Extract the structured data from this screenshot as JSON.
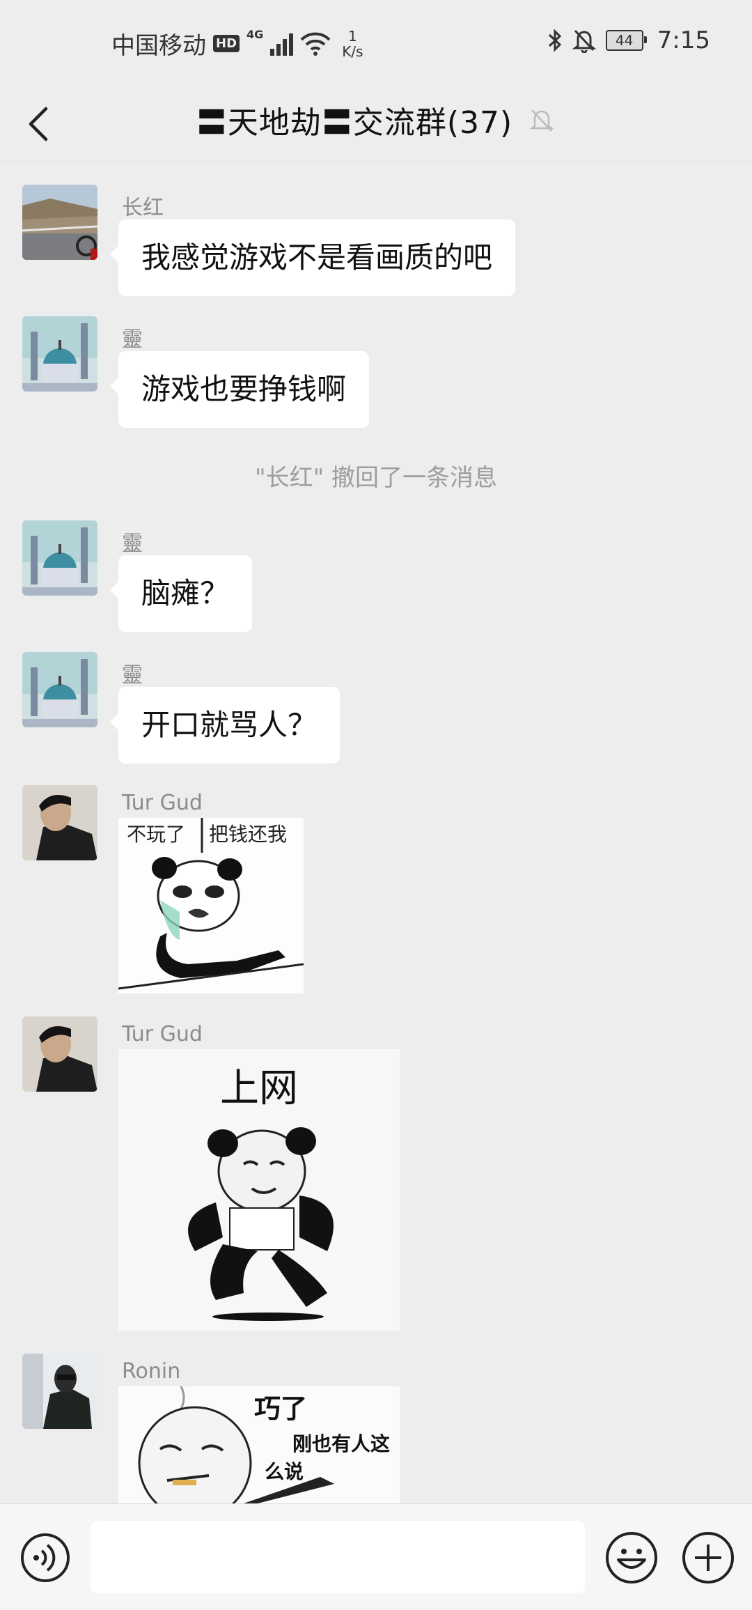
{
  "status_bar": {
    "carrier": "中国移动",
    "hd_badge": "HD",
    "network_type": "4G",
    "speed_value": "1",
    "speed_unit": "K/s",
    "battery": "44",
    "time": "7:15",
    "icons": [
      "signal-icon",
      "wifi-icon",
      "bluetooth-icon",
      "mute-notification-icon",
      "battery-icon"
    ]
  },
  "header": {
    "title": "〓天地劫〓交流群(37)",
    "icons": [
      "back-arrow-icon",
      "muted-bell-icon"
    ]
  },
  "messages": [
    {
      "sender": "长红",
      "text": "我感觉游戏不是看画质的吧",
      "avatar": "road-photo"
    },
    {
      "sender": "靈",
      "text": "游戏也要挣钱啊",
      "avatar": "cathedral-painting"
    },
    {
      "sender": "靈",
      "text": "脑瘫？",
      "avatar": "cathedral-painting"
    },
    {
      "sender": "靈",
      "text": "开口就骂人？",
      "avatar": "cathedral-painting"
    }
  ],
  "system_message": "\"长红\" 撤回了一条消息",
  "stickers": [
    {
      "sender": "Tur Gud",
      "left_caption": "不玩了",
      "right_caption": "把钱还我",
      "avatar": "man-portrait"
    },
    {
      "sender": "Tur Gud",
      "caption": "上网",
      "avatar": "man-portrait"
    },
    {
      "sender": "Ronin",
      "caption_title": "巧了",
      "caption_line1": "刚也有人这",
      "caption_line2": "么说",
      "avatar": "man-dark-photo"
    }
  ],
  "input_bar": {
    "placeholder": "",
    "value": "",
    "icons": [
      "voice-icon",
      "emoji-icon",
      "plus-icon"
    ]
  }
}
